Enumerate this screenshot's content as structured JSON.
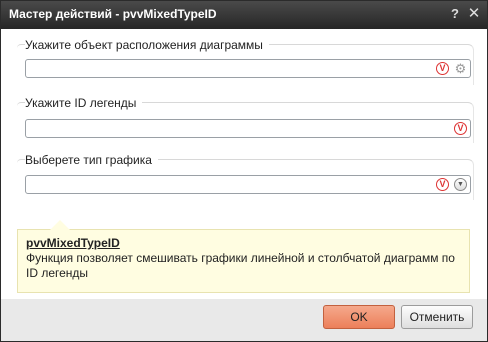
{
  "window": {
    "title": "Мастер действий - pvvMixedTypeID",
    "help_label": "?",
    "close_label": "✕"
  },
  "sections": [
    {
      "label": "Укажите объект расположения диаграммы",
      "value": ""
    },
    {
      "label": "Укажите ID легенды",
      "value": ""
    },
    {
      "label": "Выберете тип графика",
      "value": ""
    }
  ],
  "icons": {
    "validate": "V"
  },
  "info": {
    "title": "pvvMixedTypeID",
    "text": "Функция позволяет смешивать графики линейной и столбчатой диаграмм по ID легенды"
  },
  "buttons": {
    "ok": "OK",
    "cancel": "Отменить"
  },
  "colors": {
    "titlebar": "#2f2f2f",
    "ok_button": "#f09a78",
    "info_bg": "#fffde1",
    "validate_icon": "#dd3333"
  }
}
